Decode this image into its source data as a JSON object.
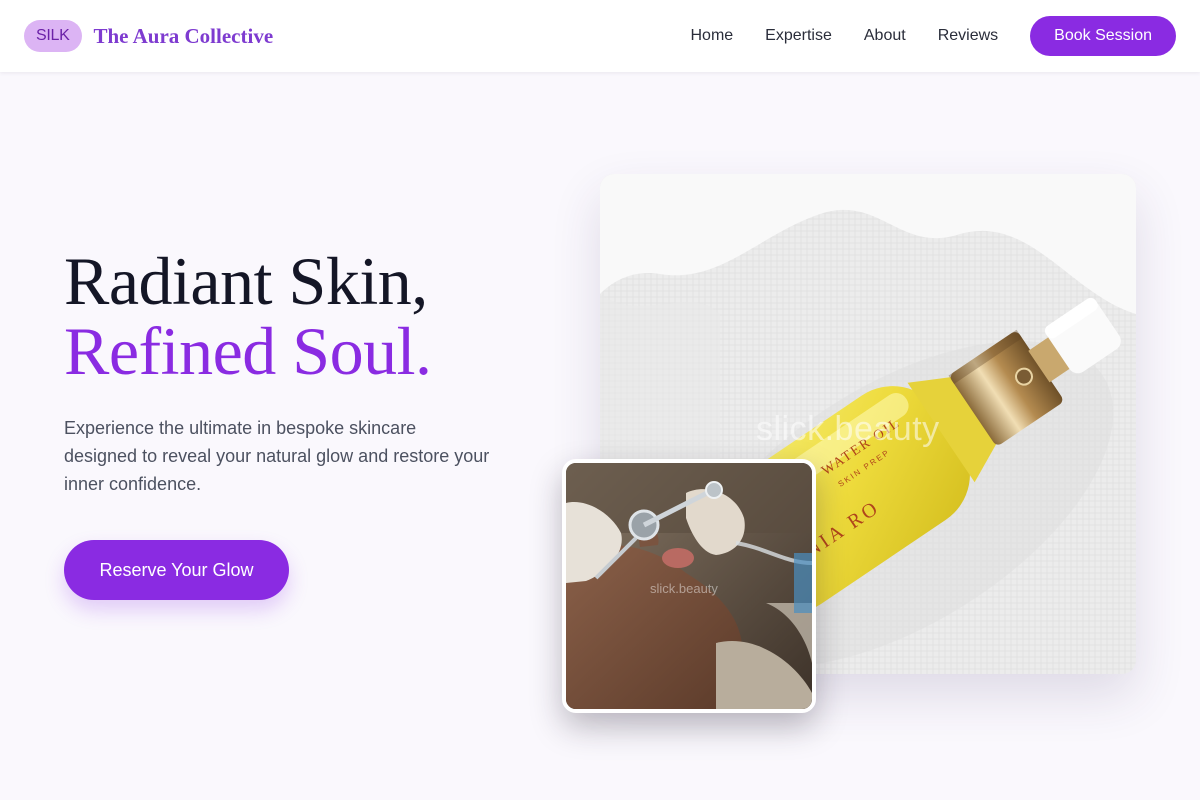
{
  "header": {
    "brand_badge": "SILK",
    "brand_name": "The Aura Collective",
    "nav": [
      {
        "label": "Home"
      },
      {
        "label": "Expertise"
      },
      {
        "label": "About"
      },
      {
        "label": "Reviews"
      }
    ],
    "cta_label": "Book Session"
  },
  "hero": {
    "title_line1": "Radiant Skin,",
    "title_line2": "Refined Soul.",
    "subtitle": "Experience the ultimate in bespoke skincare designed to reveal your natural glow and restore your inner confidence.",
    "cta_label": "Reserve Your Glow"
  },
  "images": {
    "product": {
      "bottle_label_line1": "WATER OIL",
      "bottle_label_line2": "SKIN PREP",
      "bottle_brand": "SONIA RO",
      "watermark": "slick.beauty"
    },
    "treatment": {
      "watermark": "slick.beauty"
    }
  },
  "colors": {
    "accent": "#8a2be2",
    "badge_bg": "#dcb4f4",
    "brand_text": "#7e3bd0",
    "page_bg": "#faf8fd",
    "heading_dark": "#141626",
    "body_text": "#4c5160"
  }
}
